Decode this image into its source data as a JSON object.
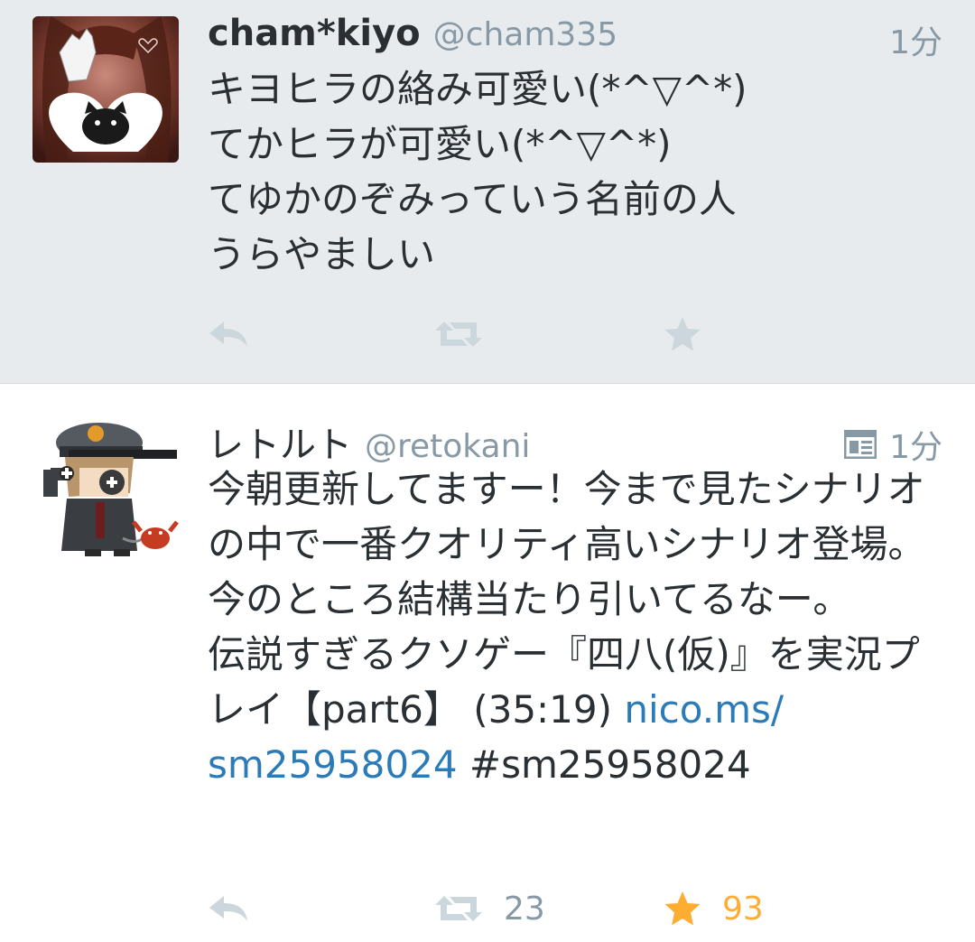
{
  "tweets": [
    {
      "name": "cham*kiyo",
      "handle": "@cham335",
      "time": "1分",
      "text": "キヨヒラの絡み可愛い(*^▽^*)\nてかヒラが可愛い(*^▽^*)\nてゆかのぞみっていう名前の人\nうらやましい",
      "avatar_icon": "cat-heart-avatar",
      "retweet_count": "",
      "favorite_count": ""
    },
    {
      "name": "レトルト",
      "handle": "@retokani",
      "time": "1分",
      "has_card_icon": true,
      "text": "今朝更新してますー！今まで見たシナリオの中で一番クオリティ高いシナリオ登場。今のところ結構当たり引いてるなー。\n伝説すぎるクソゲー『四八(仮)』を実況プレイ【part6】 (35:19) ",
      "link_text": "nico.ms/\nsm25958024",
      "hashtag": " #sm25958024",
      "avatar_icon": "pixel-character-avatar",
      "retweet_count": "23",
      "favorite_count": "93"
    }
  ],
  "colors": {
    "timeline_bg_selected": "#e8ebee",
    "text": "#292f33",
    "muted": "#8899a6",
    "icon_gray": "#ccd6dd",
    "link": "#2b7bb9",
    "favorite": "#ffac33"
  }
}
